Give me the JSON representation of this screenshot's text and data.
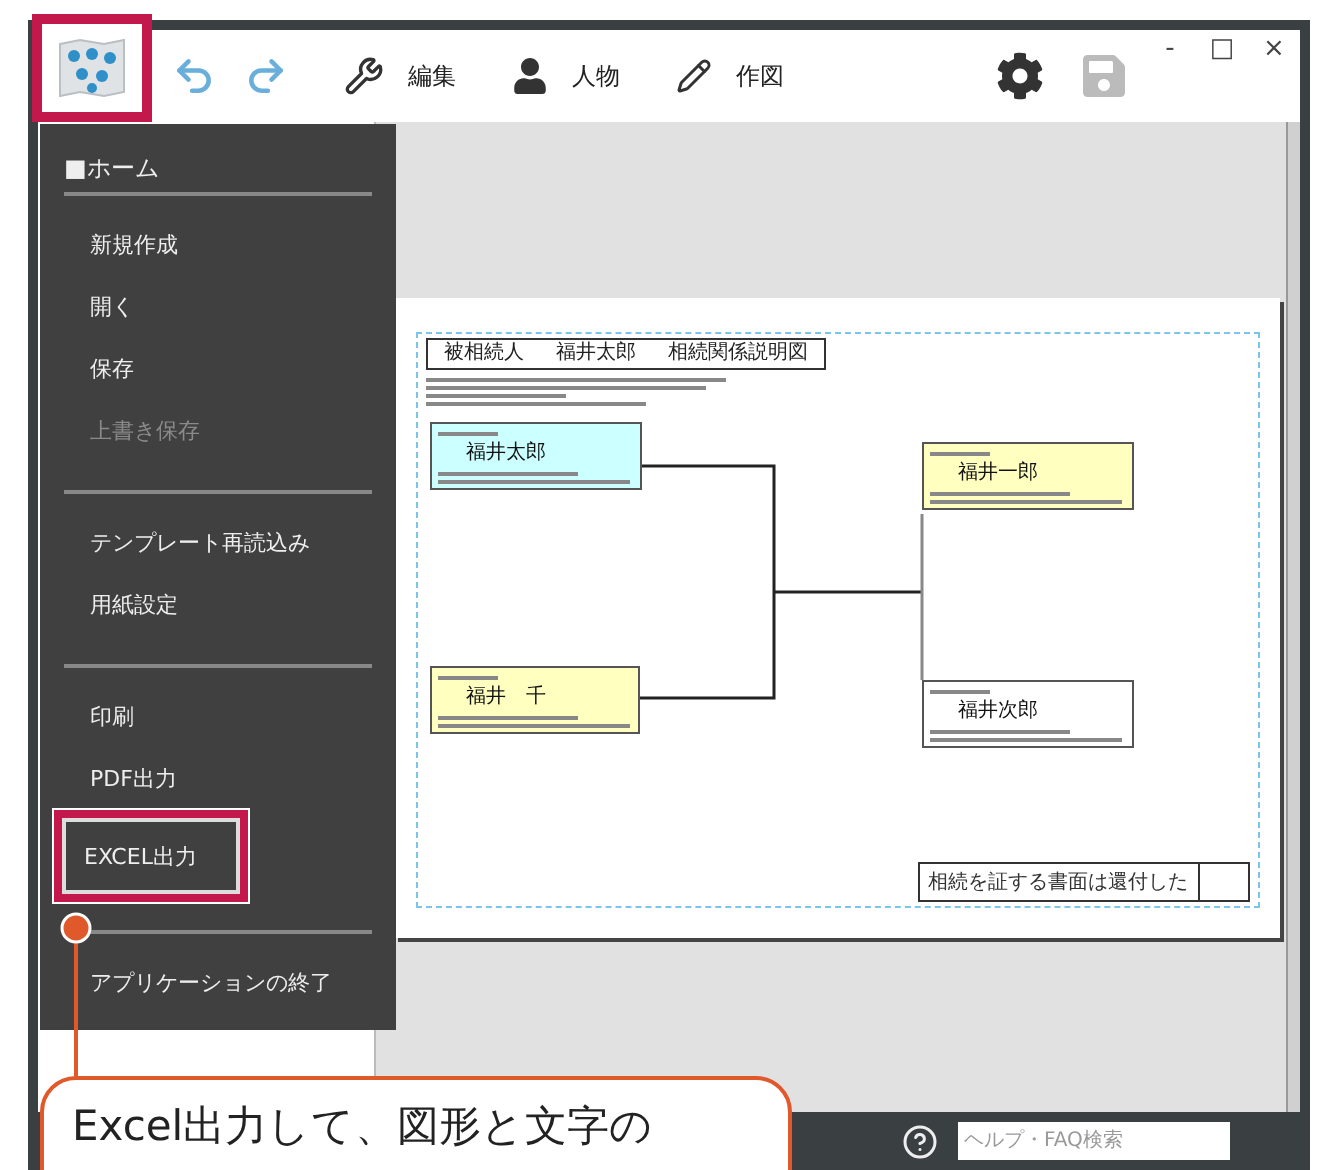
{
  "toolbar": {
    "app_icon_highlighted": true,
    "tools": [
      {
        "kind": "edit",
        "label": "編集"
      },
      {
        "kind": "person",
        "label": "人物"
      },
      {
        "kind": "draw",
        "label": "作図"
      }
    ],
    "window_controls": [
      "-",
      "□",
      "×"
    ]
  },
  "menu": {
    "title": "■ホーム",
    "sections": [
      [
        {
          "label": "新規作成",
          "disabled": false,
          "highlighted": false
        },
        {
          "label": "開く",
          "disabled": false,
          "highlighted": false
        },
        {
          "label": "保存",
          "disabled": false,
          "highlighted": false
        },
        {
          "label": "上書き保存",
          "disabled": true,
          "highlighted": false
        }
      ],
      [
        {
          "label": "テンプレート再読込み",
          "disabled": false,
          "highlighted": false
        },
        {
          "label": "用紙設定",
          "disabled": false,
          "highlighted": false
        }
      ],
      [
        {
          "label": "印刷",
          "disabled": false,
          "highlighted": false
        },
        {
          "label": "PDF出力",
          "disabled": false,
          "highlighted": false
        },
        {
          "label": "EXCEL出力",
          "disabled": false,
          "highlighted": true
        }
      ],
      [
        {
          "label": "アプリケーションの終了",
          "disabled": false,
          "highlighted": false
        }
      ]
    ]
  },
  "document": {
    "header": [
      "被相続人",
      "福井太郎",
      "相続関係説明図"
    ],
    "persons": [
      {
        "name": "福井太郎",
        "color": "#ccffff"
      },
      {
        "name": "福井　千",
        "color": "#ffffc0"
      },
      {
        "name": "福井一郎",
        "color": "#ffffc0"
      },
      {
        "name": "福井次郎",
        "color": "#ffffff"
      }
    ],
    "footer": "相続を証する書面は還付した"
  },
  "status_bar": {
    "search": {
      "placeholder": "ヘルプ・FAQ検索"
    }
  },
  "callout": {
    "text": "Excel出力して、図形と文字の"
  }
}
